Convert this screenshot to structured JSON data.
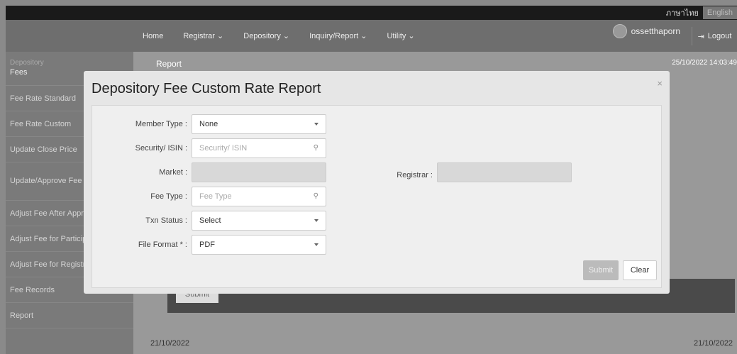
{
  "header": {
    "lang_th": "ภาษาไทย",
    "lang_en": "English",
    "nav": [
      "Home",
      "Registrar ⌄",
      "Depository ⌄",
      "Inquiry/Report ⌄",
      "Utility ⌄"
    ],
    "username": "ossetthaporn",
    "logout_label": "Logout"
  },
  "sidebar": {
    "section": "Depository",
    "heading": "Fees",
    "items": [
      "Fee Rate Standard",
      "Fee Rate Custom",
      "Update Close Price",
      "Update/Approve Fee Accounting",
      "Adjust Fee After Approve",
      "Adjust Fee for Participant",
      "Adjust Fee for Registrar",
      "Fee Records",
      "Report"
    ]
  },
  "main": {
    "title": "Report",
    "datetime": "25/10/2022 14:03:49",
    "bg_submit": "Submit",
    "date_left": "21/10/2022",
    "date_right": "21/10/2022"
  },
  "modal": {
    "title": "Depository Fee Custom Rate Report",
    "close": "×",
    "fields": {
      "member_type": {
        "label": "Member Type :",
        "value": "None"
      },
      "security_isin": {
        "label": "Security/ ISIN :",
        "placeholder": "Security/ ISIN"
      },
      "market": {
        "label": "Market :",
        "value": ""
      },
      "fee_type": {
        "label": "Fee Type :",
        "placeholder": "Fee Type"
      },
      "txn_status": {
        "label": "Txn Status :",
        "value": "Select"
      },
      "file_format": {
        "label": "File Format * :",
        "value": "PDF"
      },
      "registrar": {
        "label": "Registrar :",
        "value": ""
      }
    },
    "submit_label": "Submit",
    "clear_label": "Clear"
  }
}
